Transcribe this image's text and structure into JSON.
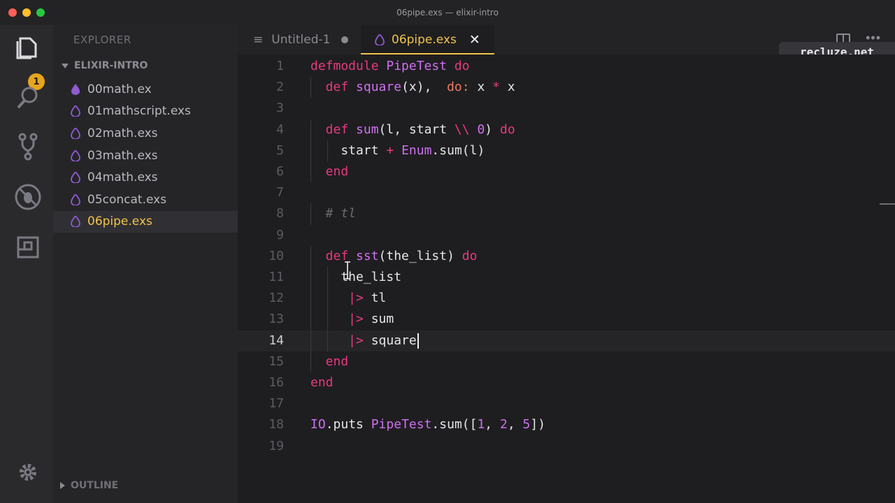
{
  "window": {
    "title": "06pipe.exs — elixir-intro"
  },
  "activity_bar": {
    "badge_count": "1"
  },
  "sidebar": {
    "title": "EXPLORER",
    "project": "ELIXIR-INTRO",
    "files": [
      "00math.ex",
      "01mathscript.exs",
      "02math.exs",
      "03math.exs",
      "04math.exs",
      "05concat.exs",
      "06pipe.exs"
    ],
    "active_file": "06pipe.exs",
    "outline": "OUTLINE"
  },
  "tabs": {
    "untitled": "Untitled-1",
    "active": "06pipe.exs",
    "close": "✕"
  },
  "watermark": "recluze.net",
  "editor": {
    "line_numbers": [
      "1",
      "2",
      "3",
      "4",
      "5",
      "6",
      "7",
      "8",
      "9",
      "10",
      "11",
      "12",
      "13",
      "14",
      "15",
      "16",
      "17",
      "18",
      "19"
    ],
    "current_line": "14",
    "lines": [
      {
        "parts": [
          [
            "kw",
            "defmodule "
          ],
          [
            "mod",
            "PipeTest"
          ],
          [
            "kw",
            " do"
          ]
        ]
      },
      {
        "parts": [
          [
            "kw",
            "  def "
          ],
          [
            "fn",
            "square"
          ],
          [
            "punct",
            "(x),  "
          ],
          [
            "atom",
            "do:"
          ],
          [
            "var",
            " x "
          ],
          [
            "kw",
            "*"
          ],
          [
            "var",
            " x"
          ]
        ]
      },
      {
        "parts": []
      },
      {
        "parts": [
          [
            "kw",
            "  def "
          ],
          [
            "fn",
            "sum"
          ],
          [
            "punct",
            "(l, start "
          ],
          [
            "kw",
            "\\\\"
          ],
          [
            "punct",
            " "
          ],
          [
            "num",
            "0"
          ],
          [
            "punct",
            ") "
          ],
          [
            "kw",
            "do"
          ]
        ]
      },
      {
        "parts": [
          [
            "var",
            "    start "
          ],
          [
            "kw",
            "+"
          ],
          [
            "punct",
            " "
          ],
          [
            "mod",
            "Enum"
          ],
          [
            "punct",
            "."
          ],
          [
            "var",
            "sum(l)"
          ]
        ]
      },
      {
        "parts": [
          [
            "kw",
            "  end"
          ]
        ]
      },
      {
        "parts": []
      },
      {
        "parts": [
          [
            "cm",
            "  # tl"
          ]
        ]
      },
      {
        "parts": []
      },
      {
        "parts": [
          [
            "kw",
            "  def "
          ],
          [
            "fn",
            "sst"
          ],
          [
            "punct",
            "(the_list) "
          ],
          [
            "kw",
            "do"
          ]
        ]
      },
      {
        "parts": [
          [
            "var",
            "    the_list"
          ]
        ]
      },
      {
        "parts": [
          [
            "kw",
            "     |>"
          ],
          [
            "var",
            " tl"
          ]
        ]
      },
      {
        "parts": [
          [
            "kw",
            "     |>"
          ],
          [
            "var",
            " sum"
          ]
        ]
      },
      {
        "parts": [
          [
            "kw",
            "     |>"
          ],
          [
            "var",
            " square"
          ]
        ]
      },
      {
        "parts": [
          [
            "kw",
            "  end"
          ]
        ]
      },
      {
        "parts": [
          [
            "kw",
            "end"
          ]
        ]
      },
      {
        "parts": []
      },
      {
        "parts": [
          [
            "mod",
            "IO"
          ],
          [
            "punct",
            "."
          ],
          [
            "var",
            "puts "
          ],
          [
            "mod",
            "PipeTest"
          ],
          [
            "punct",
            "."
          ],
          [
            "var",
            "sum(["
          ],
          [
            "num",
            "1"
          ],
          [
            "punct",
            ", "
          ],
          [
            "num",
            "2"
          ],
          [
            "punct",
            ", "
          ],
          [
            "num",
            "5"
          ],
          [
            "punct",
            "])"
          ]
        ]
      },
      {
        "parts": []
      }
    ]
  },
  "colors": {
    "accent": "#f3c34a",
    "keyword": "#e8397f",
    "identifier": "#cf6ff0"
  }
}
